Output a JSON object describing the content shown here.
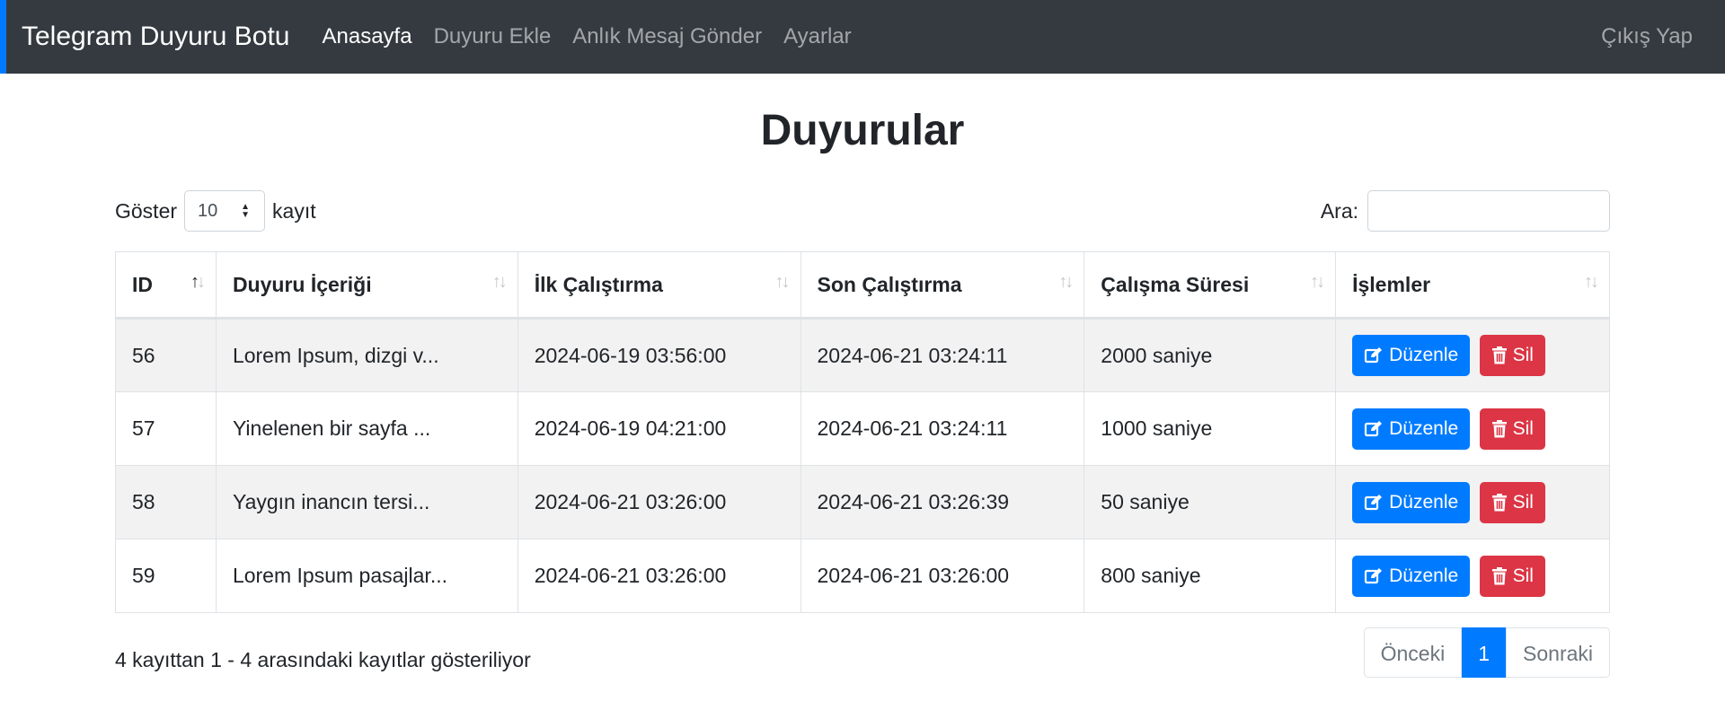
{
  "navbar": {
    "brand": "Telegram Duyuru Botu",
    "links": [
      "Anasayfa",
      "Duyuru Ekle",
      "Anlık Mesaj Gönder",
      "Ayarlar"
    ],
    "active_link": "Anasayfa",
    "logout": "Çıkış Yap"
  },
  "title": "Duyurular",
  "controls": {
    "show_label": "Göster",
    "show_value": "10",
    "records_label": "kayıt",
    "search_label": "Ara:",
    "search_value": ""
  },
  "table": {
    "headers": [
      "ID",
      "Duyuru İçeriği",
      "İlk Çalıştırma",
      "Son Çalıştırma",
      "Çalışma Süresi",
      "İşlemler"
    ],
    "rows": [
      {
        "id": "56",
        "content": "Lorem Ipsum, dizgi v...",
        "first_run": "2024-06-19 03:56:00",
        "last_run": "2024-06-21 03:24:11",
        "duration": "2000 saniye"
      },
      {
        "id": "57",
        "content": "Yinelenen bir sayfa ...",
        "first_run": "2024-06-19 04:21:00",
        "last_run": "2024-06-21 03:24:11",
        "duration": "1000 saniye"
      },
      {
        "id": "58",
        "content": "Yaygın inancın tersi...",
        "first_run": "2024-06-21 03:26:00",
        "last_run": "2024-06-21 03:26:39",
        "duration": "50 saniye"
      },
      {
        "id": "59",
        "content": "Lorem Ipsum pasajlar...",
        "first_run": "2024-06-21 03:26:00",
        "last_run": "2024-06-21 03:26:00",
        "duration": "800 saniye"
      }
    ],
    "edit_label": "Düzenle",
    "delete_label": "Sil"
  },
  "footer": {
    "info": "4 kayıttan 1 - 4 arasındaki kayıtlar gösteriliyor",
    "prev": "Önceki",
    "current_page": "1",
    "next": "Sonraki"
  },
  "colors": {
    "navbar_bg": "#343a40",
    "primary": "#007bff",
    "danger": "#dc3545",
    "stripe": "#f2f2f2"
  },
  "icons": {
    "edit": "pen-to-square-icon",
    "delete": "trash-icon",
    "sort": "sort-arrows-icon"
  }
}
